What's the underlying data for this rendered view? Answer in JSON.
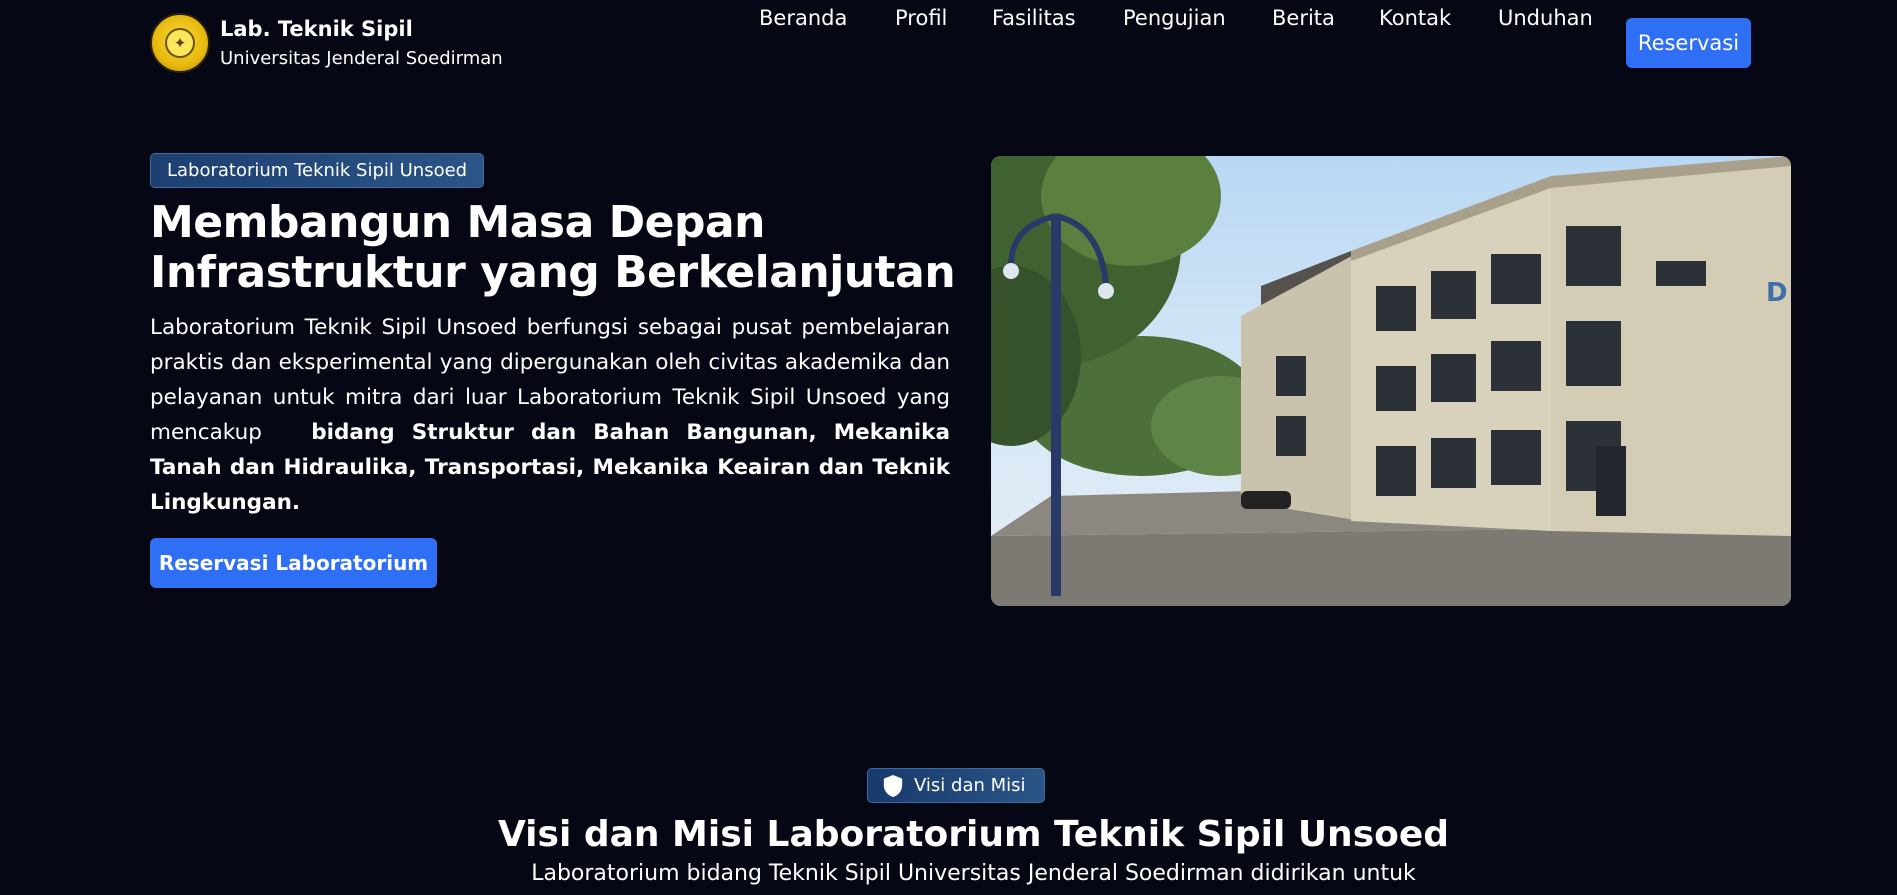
{
  "brand": {
    "title": "Lab. Teknik Sipil",
    "subtitle": "Universitas Jenderal Soedirman",
    "logo_icon": "university-seal"
  },
  "nav": {
    "items": [
      {
        "label": "Beranda"
      },
      {
        "label": "Profil"
      },
      {
        "label": "Fasilitas"
      },
      {
        "label": "Pengujian"
      },
      {
        "label": "Berita"
      },
      {
        "label": "Kontak"
      },
      {
        "label": "Unduhan"
      }
    ],
    "cta_label": "Reservasi"
  },
  "hero": {
    "badge": "Laboratorium Teknik Sipil Unsoed",
    "title": "Membangun Masa Depan Infrastruktur yang Berkelanjutan",
    "description_plain": "Laboratorium Teknik Sipil Unsoed berfungsi sebagai pusat pembelajaran praktis dan eksperimental yang dipergunakan oleh civitas akademika dan pelayanan untuk mitra dari luar Laboratorium Teknik Sipil Unsoed yang mencakup",
    "description_bold": "bidang Struktur dan Bahan Bangunan, Mekanika Tanah dan Hidraulika, Transportasi, Mekanika Keairan dan Teknik Lingkungan.",
    "cta_label": "Reservasi Laboratorium",
    "image_sign": "D"
  },
  "visi_misi": {
    "badge": "Visi dan Misi",
    "badge_icon": "shield-icon",
    "title": "Visi dan Misi Laboratorium Teknik Sipil Unsoed",
    "description": "Laboratorium bidang Teknik Sipil Universitas Jenderal Soedirman didirikan untuk"
  },
  "colors": {
    "background": "#050814",
    "accent": "#2f6ff5",
    "badge": "#1d3f72"
  }
}
